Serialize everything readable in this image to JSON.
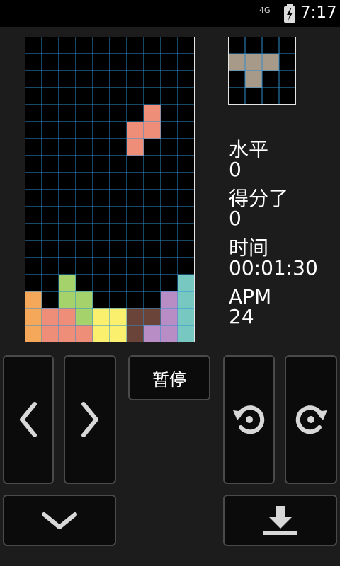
{
  "status_bar": {
    "network": "4G",
    "time": "7:17"
  },
  "stats": {
    "level_label": "水平",
    "level_value": "0",
    "score_label": "得分了",
    "score_value": "0",
    "time_label": "时间",
    "time_value": "00:01:30",
    "apm_label": "APM",
    "apm_value": "24"
  },
  "controls": {
    "pause_label": "暂停",
    "icons": [
      "chevron-left-icon",
      "chevron-right-icon",
      "rotate-left-icon",
      "rotate-right-icon",
      "chevron-down-icon",
      "hard-drop-icon"
    ]
  },
  "colors": {
    "background": "#1c1c1c",
    "grid_line": "#2e8fd0",
    "blocks": {
      "O": "#f6a85a",
      "S": "#ee8e78",
      "T": "#a6d26c",
      "Y": "#fbf06e",
      "B": "#6a4438",
      "P": "#b88cc4",
      "C": "#78c8c2",
      "G": "#a89a88"
    }
  },
  "board": {
    "columns": 10,
    "rows": 18,
    "cells": [
      "..........",
      "..........",
      "..........",
      "..........",
      ".......S..",
      "......SS..",
      "......S...",
      "..........",
      "..........",
      "..........",
      "..........",
      "..........",
      "..........",
      "..........",
      "..T......C",
      "O.TT....PC",
      "OSSTYYBBPC",
      "OSSSYYBPPC"
    ]
  },
  "next_piece": {
    "columns": 4,
    "rows": 4,
    "cells": [
      "....",
      "GGG.",
      ".G..",
      "...."
    ]
  }
}
